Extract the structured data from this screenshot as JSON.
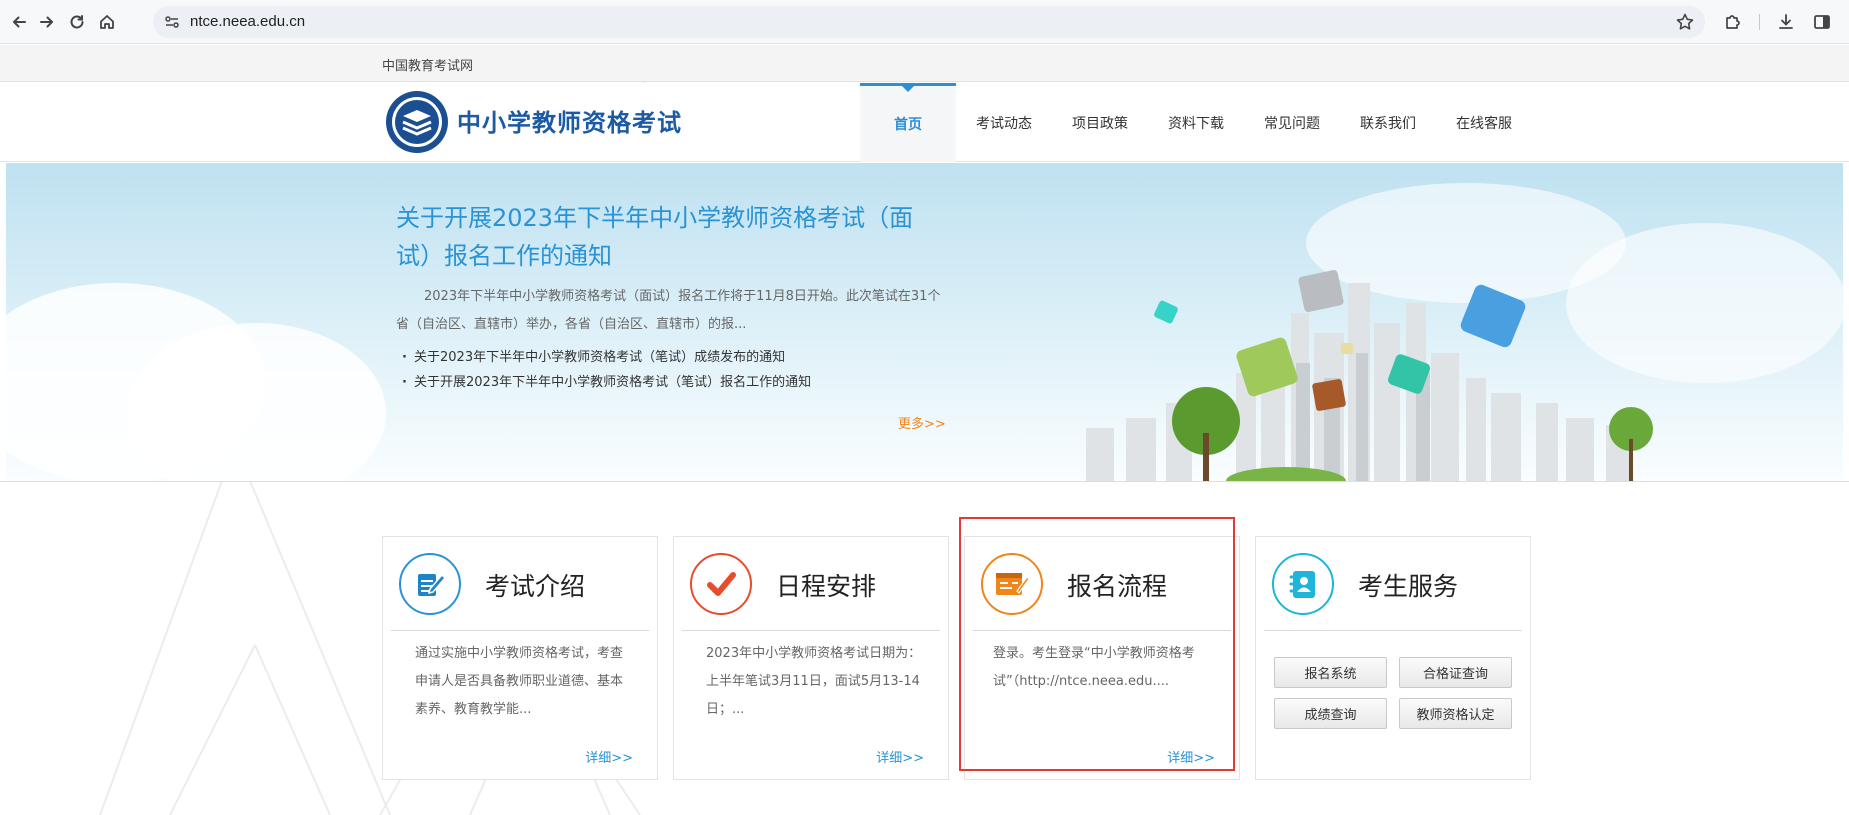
{
  "browser": {
    "url": "ntce.neea.edu.cn",
    "accent": "#1a73e8"
  },
  "topbar": {
    "link": "中国教育考试网"
  },
  "header": {
    "title": "中小学教师资格考试",
    "nav": [
      {
        "label": "首页",
        "active": true
      },
      {
        "label": "考试动态"
      },
      {
        "label": "项目政策"
      },
      {
        "label": "资料下载"
      },
      {
        "label": "常见问题"
      },
      {
        "label": "联系我们"
      },
      {
        "label": "在线客服"
      }
    ]
  },
  "banner": {
    "headline": "关于开展2023年下半年中小学教师资格考试（面试）报名工作的通知",
    "summary": "2023年下半年中小学教师资格考试（面试）报名工作将于11月8日开始。此次笔试在31个省（自治区、直辖市）举办，各省（自治区、直辖市）的报...",
    "news": [
      "关于2023年下半年中小学教师资格考试（笔试）成绩发布的通知",
      "关于开展2023年下半年中小学教师资格考试（笔试）报名工作的通知"
    ],
    "more": "更多>>"
  },
  "cards": [
    {
      "title": "考试介绍",
      "icon": "pencil-document-icon",
      "color": "#2a93d5",
      "body": "通过实施中小学教师资格考试，考查申请人是否具备教师职业道德、基本素养、教育教学能...",
      "more": "详细>>"
    },
    {
      "title": "日程安排",
      "icon": "checkmark-icon",
      "color": "#e84c2b",
      "body": "2023年中小学教师资格考试日期为：上半年笔试3月11日，面试5月13-14日；...",
      "more": "详细>>"
    },
    {
      "title": "报名流程",
      "icon": "registration-form-icon",
      "color": "#f08519",
      "body": "登录。考生登录“中小学教师资格考试”（http://ntce.neea.edu....",
      "more": "详细>>"
    },
    {
      "title": "考生服务",
      "icon": "address-book-icon",
      "color": "#1fb5d8",
      "buttons": [
        "报名系统",
        "合格证查询",
        "成绩查询",
        "教师资格认定"
      ]
    }
  ]
}
